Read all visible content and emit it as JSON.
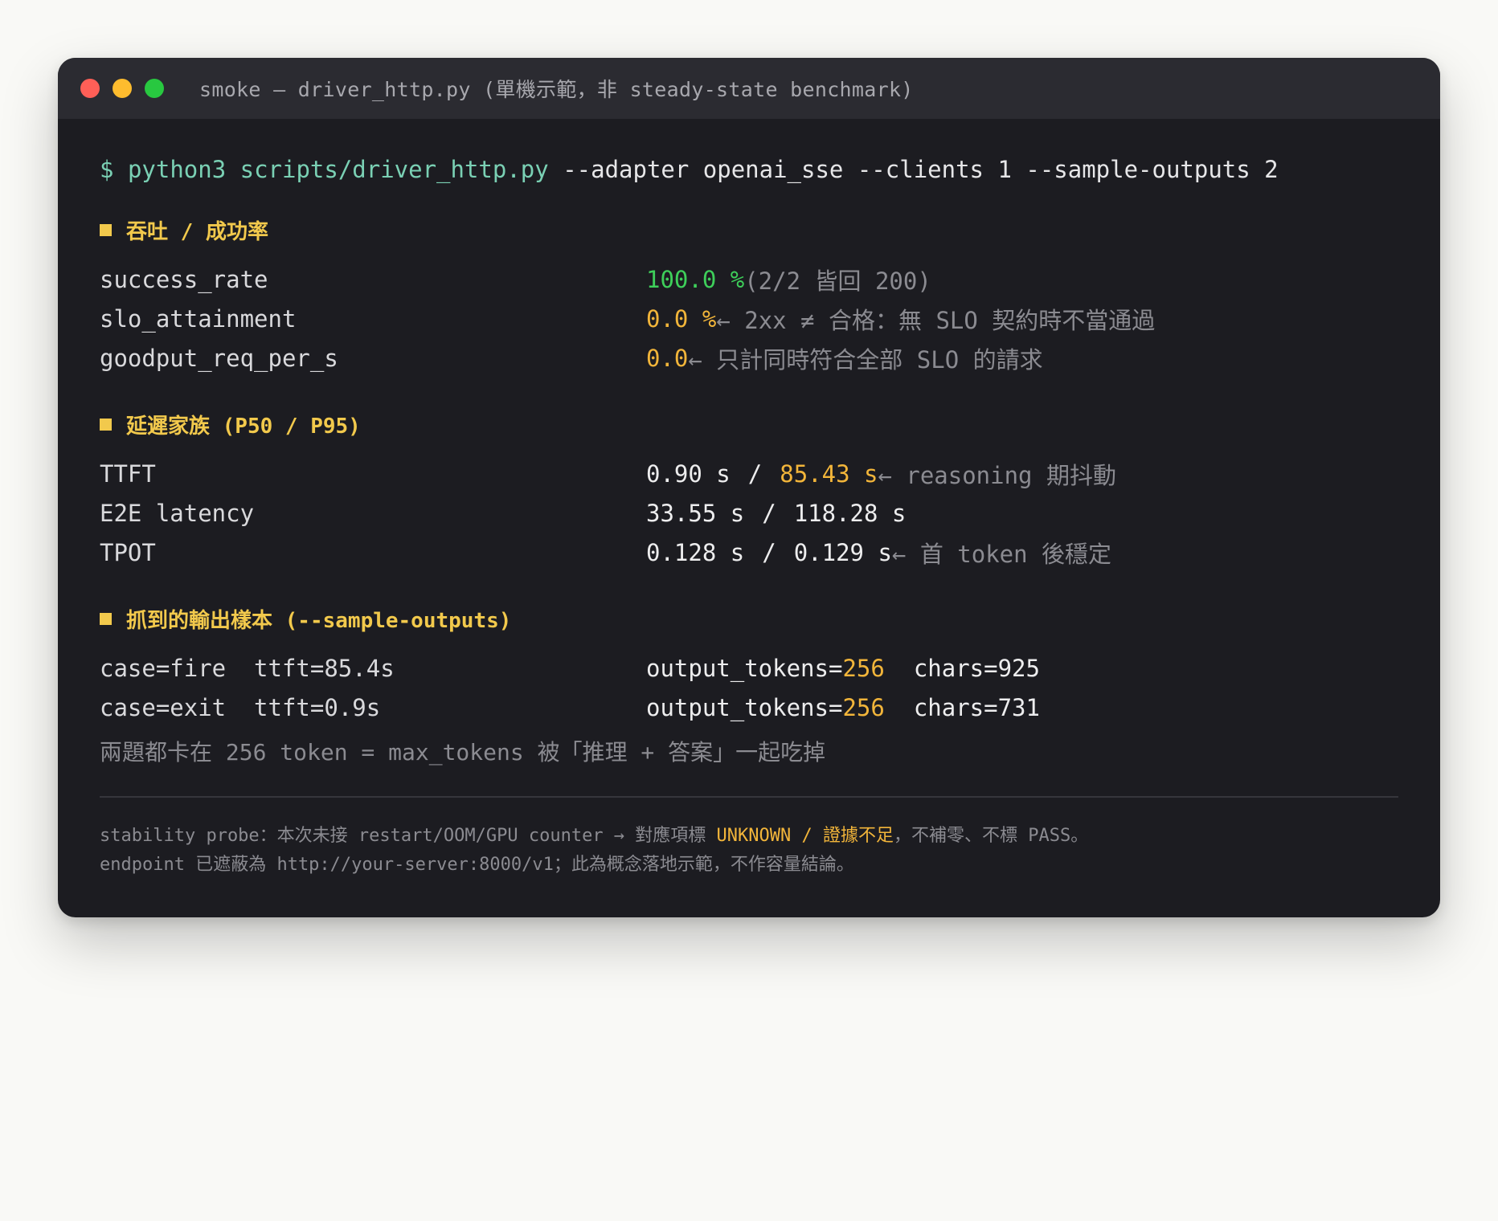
{
  "window": {
    "title": "smoke — driver_http.py (單機示範，非 steady-state benchmark)"
  },
  "command": {
    "prompt": "$",
    "program": "python3 scripts/driver_http.py",
    "args": "--adapter openai_sse --clients 1 --sample-outputs 2"
  },
  "throughput": {
    "title": "吞吐 / 成功率",
    "rows": [
      {
        "label": "success_rate",
        "value": "100.0 %",
        "note": "(2/2 皆回 200)"
      },
      {
        "label": "slo_attainment",
        "value": "0.0 %",
        "note": "← 2xx ≠ 合格：無 SLO 契約時不當通過"
      },
      {
        "label": "goodput_req_per_s",
        "value": "0.0",
        "note": "← 只計同時符合全部 SLO 的請求"
      }
    ]
  },
  "latency": {
    "title": "延遲家族 (P50 / P95)",
    "rows": [
      {
        "label": "TTFT",
        "p50": "0.90 s",
        "sep": "/",
        "p95": "85.43 s",
        "note": "← reasoning 期抖動"
      },
      {
        "label": "E2E latency",
        "p50": "33.55 s",
        "sep": "/",
        "p95": "118.28 s",
        "note": ""
      },
      {
        "label": "TPOT",
        "p50": "0.128 s",
        "sep": "/",
        "p95": "0.129 s",
        "note": "← 首 token 後穩定"
      }
    ]
  },
  "samples": {
    "title": "抓到的輸出樣本 (--sample-outputs)",
    "rows": [
      {
        "label": "case=fire  ttft=85.4s",
        "tokens_key": "output_tokens=",
        "tokens_val": "256",
        "chars": "chars=925"
      },
      {
        "label": "case=exit  ttft=0.9s",
        "tokens_key": "output_tokens=",
        "tokens_val": "256",
        "chars": "chars=731"
      }
    ],
    "summary": "兩題都卡在 256 token = max_tokens 被「推理 + 答案」一起吃掉"
  },
  "footer": {
    "line1_pre": "stability probe：本次未接 restart/OOM/GPU counter → 對應項標 ",
    "line1_highlight": "UNKNOWN / 證據不足",
    "line1_post": "，不補零、不標 PASS。",
    "line2": "endpoint 已遮蔽為 http://your-server:8000/v1；此為概念落地示範，不作容量結論。"
  },
  "colors": {
    "accent_yellow": "#f2c94c",
    "value_green": "#3ecf5a",
    "value_orange": "#f2b53a",
    "command_teal": "#7ad0b4"
  }
}
